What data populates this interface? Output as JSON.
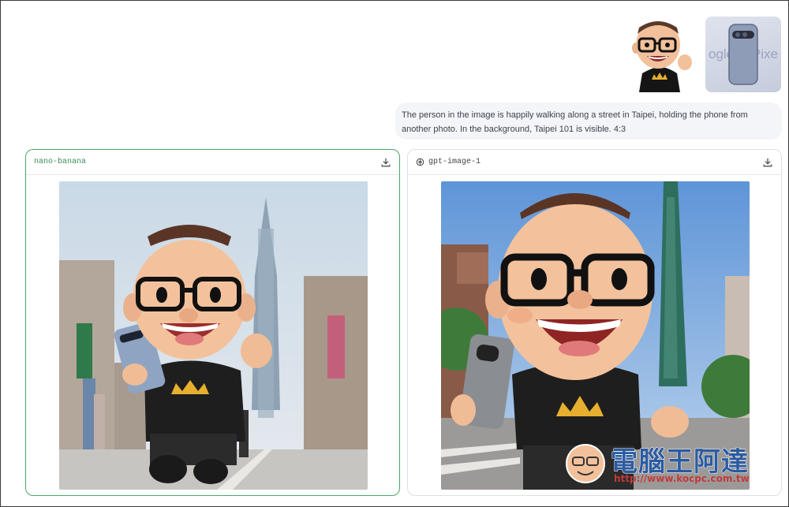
{
  "attachments": {
    "image_1": "character-image",
    "image_2_text_left": "ogle",
    "image_2_text_right": "Pixe"
  },
  "prompt": {
    "text": "The person in the image is happily walking along a street in Taipei, holding the phone from another photo. In the background, Taipei 101 is visible. 4:3"
  },
  "results": [
    {
      "model": "nano-banana",
      "selected": true
    },
    {
      "model": "gpt-image-1",
      "selected": false
    }
  ],
  "watermark": {
    "title": "電腦王阿達",
    "url": "http://www.kocpc.com.tw"
  },
  "colors": {
    "selected_border": "#4aa86a",
    "prompt_bg": "#f3f5f8",
    "watermark_blue": "#2b5ba0",
    "watermark_red": "#c23b3b"
  }
}
